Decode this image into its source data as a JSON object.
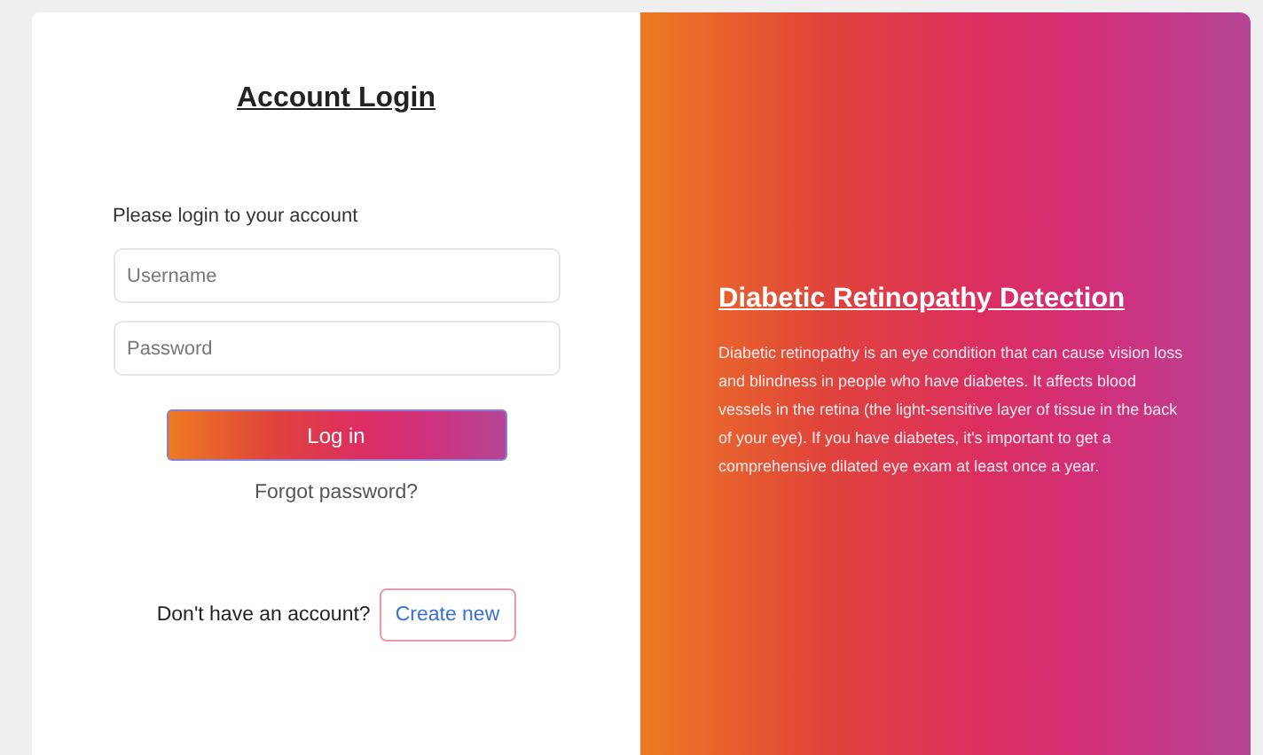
{
  "login": {
    "title": "Account Login",
    "prompt": "Please login to your account",
    "username": {
      "placeholder": "Username"
    },
    "password": {
      "placeholder": "Password"
    },
    "submit": "Log in",
    "forgot": "Forgot password?",
    "signup_prompt": "Don't have an account?",
    "signup_button": "Create new"
  },
  "info": {
    "title": "Diabetic Retinopathy Detection",
    "body": "Diabetic retinopathy is an eye condition that can cause vision loss and blindness in people who have diabetes. It affects blood vessels in the retina (the light-sensitive layer of tissue in the back of your eye). If you have diabetes, it's important to get a comprehensive dilated eye exam at least once a year."
  }
}
